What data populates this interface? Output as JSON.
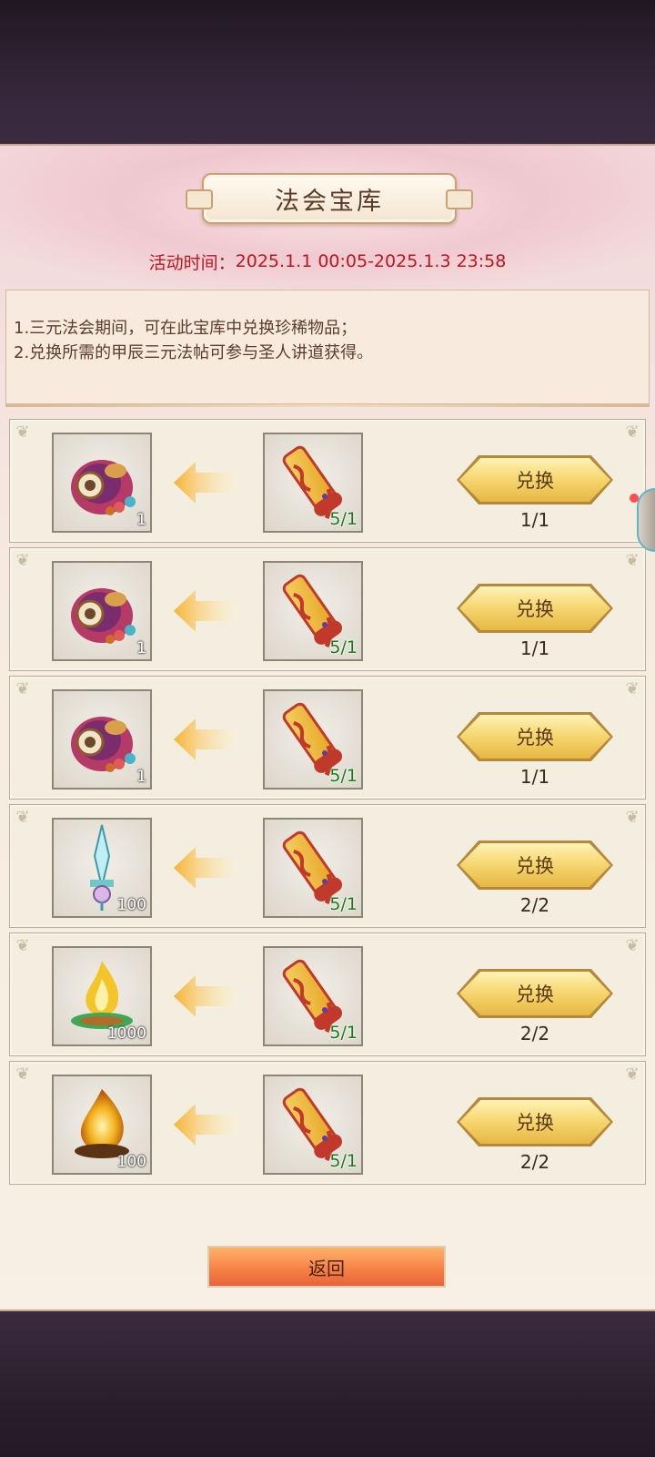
{
  "title": "法会宝库",
  "activity_time": {
    "label": "活动时间：",
    "value": "2025.1.1 00:05-2025.1.3 23:58"
  },
  "description": [
    "1.三元法会期间，可在此宝库中兑换珍稀物品；",
    "2.兑换所需的甲辰三元法帖可参与圣人讲道获得。"
  ],
  "exchange_items": [
    {
      "reward_icon": "gourd-treasure-icon",
      "reward_qty": "1",
      "cost_icon": "red-scroll-icon",
      "cost_qty": "5/1",
      "button": "兑换",
      "limit": "1/1"
    },
    {
      "reward_icon": "gourd-treasure-icon",
      "reward_qty": "1",
      "cost_icon": "red-scroll-icon",
      "cost_qty": "5/1",
      "button": "兑换",
      "limit": "1/1"
    },
    {
      "reward_icon": "gourd-treasure-icon",
      "reward_qty": "1",
      "cost_icon": "red-scroll-icon",
      "cost_qty": "5/1",
      "button": "兑换",
      "limit": "1/1"
    },
    {
      "reward_icon": "crystal-sword-icon",
      "reward_qty": "100",
      "cost_icon": "red-scroll-icon",
      "cost_qty": "5/1",
      "button": "兑换",
      "limit": "2/2"
    },
    {
      "reward_icon": "jade-flame-icon",
      "reward_qty": "1000",
      "cost_icon": "red-scroll-icon",
      "cost_qty": "5/1",
      "button": "兑换",
      "limit": "2/2"
    },
    {
      "reward_icon": "golden-fire-icon",
      "reward_qty": "100",
      "cost_icon": "red-scroll-icon",
      "cost_qty": "5/1",
      "button": "兑换",
      "limit": "2/2"
    }
  ],
  "back_button": "返回",
  "colors": {
    "time_text": "#c0141e",
    "cost_qty": "#187a18",
    "button_gold": "#f7d873",
    "back_orange": "#f57f45"
  }
}
